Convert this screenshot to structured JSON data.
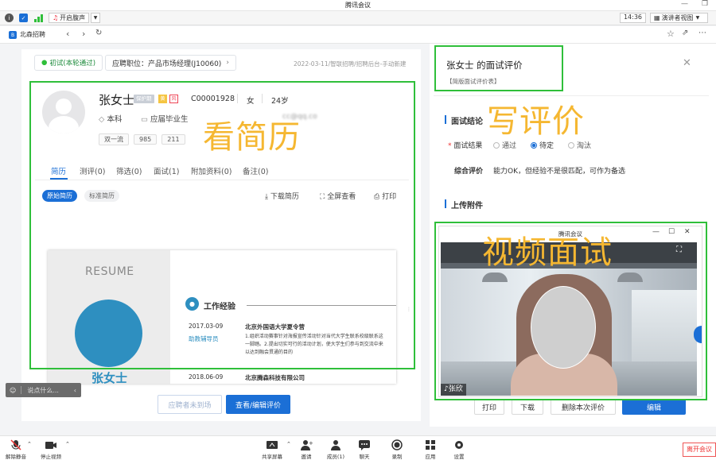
{
  "window": {
    "title": "腾讯会议"
  },
  "meeting_bar": {
    "share_label": "开启腹声",
    "time": "14:36",
    "view_label": "演讲者视图"
  },
  "browser": {
    "tab_title": "北森招聘"
  },
  "stage": {
    "label": "初试(本轮通过)",
    "position": "应聘职位：产品市场经理(J10060)",
    "meta": "2022-03-11/智联招聘/招聘后台-手动新建"
  },
  "candidate": {
    "name": "张女士",
    "badge_protect": "保护期",
    "badge_y": "黄",
    "badge_p": "风",
    "id": "C00001928",
    "gender": "女",
    "age": "24岁",
    "education": "本科",
    "grad": "应届毕业生",
    "email_masked": "cc@qq.co",
    "tags": [
      "双一流",
      "985",
      "211"
    ]
  },
  "tabs": [
    "简历",
    "测评(0)",
    "筛选(0)",
    "面试(1)",
    "附加资料(0)",
    "备注(0)"
  ],
  "subtabs": [
    "原始简历",
    "标准简历"
  ],
  "resume_actions": [
    "下载简历",
    "全屏查看",
    "打印"
  ],
  "resume": {
    "heading": "RESUME",
    "name": "张女士",
    "section": "工作经验",
    "items": [
      {
        "date": "2017.03-09",
        "role": "助教辅导员",
        "company": "北京外国语大学夏令营",
        "desc": "1.组织活动赛事针对海报宣传活动针对当代大学生联系校级联系这一脚踏。2.提出切实可行的活动计划，使大学生们参与到交流中来以达到融会贯通的目的"
      },
      {
        "date": "2018.06-09",
        "role": "",
        "company": "北京腾森科技有限公司",
        "desc": ""
      }
    ]
  },
  "left_buttons": {
    "absent": "应聘者未到场",
    "view_edit": "查看/编辑评价"
  },
  "chat_placeholder": "说点什么...",
  "overlays": {
    "resume": "看简历",
    "eval": "写评价",
    "video": "视频面试"
  },
  "eval": {
    "title": "张女士 的面试评价",
    "form_name": "【简版面试评价表】",
    "section_conclusion": "面试结论",
    "result_label": "面试结果",
    "options": [
      "通过",
      "待定",
      "淘汰"
    ],
    "selected": "待定",
    "comment_label": "综合评价",
    "comment": "能力OK，但经验不是很匹配，可作为备选",
    "section_upload": "上传附件"
  },
  "video": {
    "title": "腾讯会议",
    "person": "张欣"
  },
  "eval_buttons": {
    "print": "打印",
    "download": "下载",
    "delete": "删除本次评价",
    "edit": "编辑"
  },
  "toolbar": {
    "mute": "解除静音",
    "video": "停止视频",
    "share": "共享屏幕",
    "invite": "邀请",
    "members": "成员(1)",
    "chat": "聊天",
    "record": "录制",
    "apps": "应用",
    "settings": "设置",
    "leave": "离开会议"
  },
  "colors": {
    "primary": "#1b6fd6",
    "highlight": "#2fbf3a",
    "overlay": "#f5b731"
  }
}
